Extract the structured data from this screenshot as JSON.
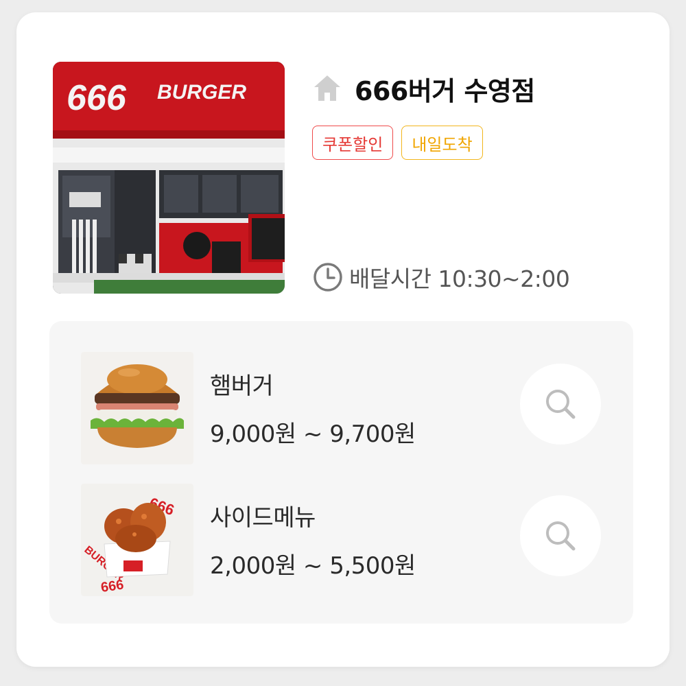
{
  "store": {
    "name": "666버거 수영점",
    "photo_sign": "666 BURGER",
    "badges": [
      {
        "label": "쿠폰할인",
        "color": "#e53935"
      },
      {
        "label": "내일도착",
        "color": "#f0a500"
      }
    ],
    "delivery": {
      "label": "배달시간",
      "hours": "10:30~2:00"
    }
  },
  "icons": {
    "home": "home-icon",
    "clock": "clock-icon",
    "search": "search-icon"
  },
  "menu": [
    {
      "name": "햄버거",
      "price": "9,000원 ~ 9,700원"
    },
    {
      "name": "사이드메뉴",
      "price": "2,000원 ~ 5,500원"
    }
  ],
  "colors": {
    "coupon_badge": "#ef4a4a",
    "arrival_badge": "#f2b51b",
    "brand_red": "#d61f26"
  }
}
